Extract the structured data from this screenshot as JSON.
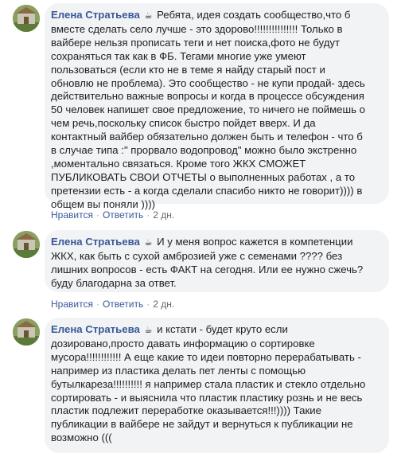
{
  "comments": [
    {
      "author": "Елена Стратьева",
      "emoji": "☕",
      "lines": [
        "Ребята, идея создать сообщество,что б",
        "вместе сделать село лучше - это здорово!!!!!!!!!!!!!!! Только в",
        "вайбере нельзя прописать теги и нет поиска,фото не будут",
        "сохраняться так как в ФБ. Тегами многие уже умеют",
        "пользоваться (если кто не в теме я найду старый пост и",
        "обновлю не проблема). Это сообщество - не купи продай- здесь",
        "действительно важные вопросы и когда в процессе обсуждения",
        "50 человек напишет свое предложение, то ничего не поймешь о",
        "чем речь,поскольку список быстро пойдет вверх. И да",
        "контактный вайбер обязательно должен быть и телефон - что б",
        "в случае типа :\" прорвало водопровод\" можно было экстренно",
        ",моментально связаться. Кроме того ЖКХ СМОЖЕТ",
        "ПУБЛИКОВАТЬ СВОИ ОТЧЕТЫ о выполненных работах , а то",
        "претензии есть - а когда сделали спасибо никто не говорит)))) в",
        "общем вы поняли ))))"
      ],
      "like": "Нравится",
      "reply": "Ответить",
      "time": "2 дн."
    },
    {
      "author": "Елена Стратьева",
      "emoji": "☕",
      "lines": [
        "И у меня вопрос кажется в компетенции",
        "ЖКХ, как быть с сухой амброзией уже с семенами ???? без",
        "лишних вопросов - есть ФАКТ на сегодня. Или ее нужно сжечь?",
        "буду благодарна за ответ."
      ],
      "like": "Нравится",
      "reply": "Ответить",
      "time": "2 дн."
    },
    {
      "author": "Елена Стратьева",
      "emoji": "☕",
      "lines": [
        "и кстати - будет круто если",
        "дозировано,просто давать информацию о сортировке",
        "мусора!!!!!!!!!!!! А еще какие то идеи повторно перерабатывать -",
        "например из пластика делать пет ленты с помощью",
        "бутылкареза!!!!!!!!!! я например стала пластик и стекло отдельно",
        "сортировать - и выяснила что пластик пластику рознь и не весь",
        "пластик подлежит переработке оказывается!!!)))) Такие",
        "публикации в вайбере не зайдут и вернуться к публикации не",
        "возможно ((("
      ]
    }
  ]
}
